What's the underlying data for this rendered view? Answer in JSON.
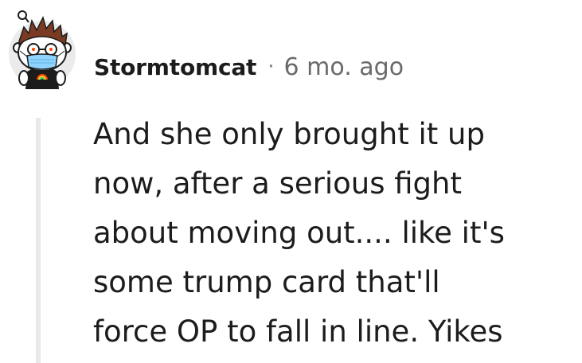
{
  "comment": {
    "author": "Stormtomcat",
    "separator": "·",
    "timestamp": "6 mo. ago",
    "avatar_icon": "snoo-avatar-with-face-mask-icon",
    "body_lines": [
      "And she only brought it up",
      "now, after a serious fight",
      "about moving out.... like it's",
      "some trump card that'll",
      "force OP to fall in line. Yikes"
    ]
  },
  "colors": {
    "text": "#1c1c1c",
    "meta": "#6a6a6a",
    "thread_line": "#e9e9e9",
    "background": "#ffffff"
  }
}
